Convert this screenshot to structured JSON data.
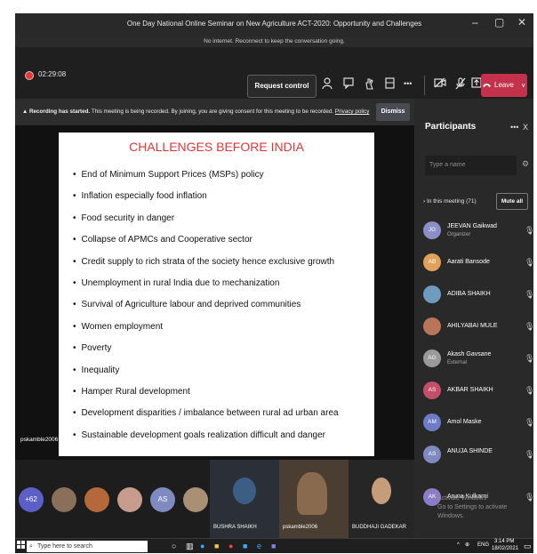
{
  "window": {
    "title": "One Day National Online Seminar on New Agriculture ACT-2020: Opportunity and Challenges",
    "controls": [
      "–",
      "▢",
      "✕"
    ]
  },
  "connection_notice": "No internet. Reconnect to keep the conversation going.",
  "toolbar": {
    "timer": "02:29:08",
    "request_control": "Request control",
    "leave": "Leave",
    "leave_caret": "∨",
    "more": "•••"
  },
  "recording_banner": {
    "bold": "Recording has started.",
    "text": " This meeting is being recorded. By joining, you are giving consent for this meeting to be recorded. ",
    "link": "Privacy policy",
    "dismiss": "Dismiss"
  },
  "slide": {
    "title": "CHALLENGES BEFORE INDIA",
    "bullets": [
      "End of Minimum Support Prices (MSPs)  policy",
      "Inflation  especially food inflation",
      "Food security in danger",
      "Collapse of  APMCs  and Cooperative sector",
      "Credit supply  to rich strata of the society hence exclusive growth",
      "Unemployment in rural India due to mechanization",
      "Survival   of Agriculture labour and  deprived communities",
      "Women employment",
      "Poverty",
      "Inequality",
      "Hamper Rural development",
      "Development disparities / imbalance   between rural ad urban  area",
      "Sustainable development goals realization difficult  and danger"
    ],
    "shared_by": "pskamble2006"
  },
  "participants": {
    "title": "Participants",
    "more": "•••",
    "close": "X",
    "search_placeholder": "Type a name",
    "in_meeting": "In this meeting (71)",
    "mute_all": "Mute all",
    "list": [
      {
        "initials": "JG",
        "name": "JEEVAN Gaikwad",
        "role": "Organizer",
        "color": "#8b8fc7"
      },
      {
        "initials": "AB",
        "name": "Aarati Bansode",
        "role": "",
        "color": "#e0a15a"
      },
      {
        "initials": "",
        "name": "ADIBA SHAIKH",
        "role": "",
        "color": "#6f9bbf"
      },
      {
        "initials": "",
        "name": "AHILYABAI MULE",
        "role": "",
        "color": "#b8755a"
      },
      {
        "initials": "AG",
        "name": "Akash Gavsane",
        "role": "External",
        "color": "#9a9a9a"
      },
      {
        "initials": "AS",
        "name": "AKBAR SHAIKH",
        "role": "",
        "color": "#c24e6a"
      },
      {
        "initials": "AM",
        "name": "Amol Maske",
        "role": "",
        "color": "#6e7cc6"
      },
      {
        "initials": "AS",
        "name": "ANUJA SHINDE",
        "role": "",
        "color": "#7f8bc0"
      },
      {
        "initials": "AK",
        "name": "Aruna Kulkarni",
        "role": "",
        "color": "#8c7cc6"
      }
    ]
  },
  "activation_watermark": [
    "Activate Windows",
    "Go to Settings to activate Windows."
  ],
  "video_strip": {
    "overflow_count": "+62",
    "avatar_initials": "AS",
    "tiles": [
      "BUSHRA SHAIKH",
      "pskamble2006",
      "BUDDHAJI GADEKAR"
    ]
  },
  "taskbar": {
    "search_placeholder": "Type here to search",
    "language": "ENG",
    "time": "3:14 PM",
    "date": "18/02/2021"
  },
  "colors": {
    "leave": "#c4314b",
    "slide_title": "#e03838",
    "recording": "#e03a3a"
  }
}
